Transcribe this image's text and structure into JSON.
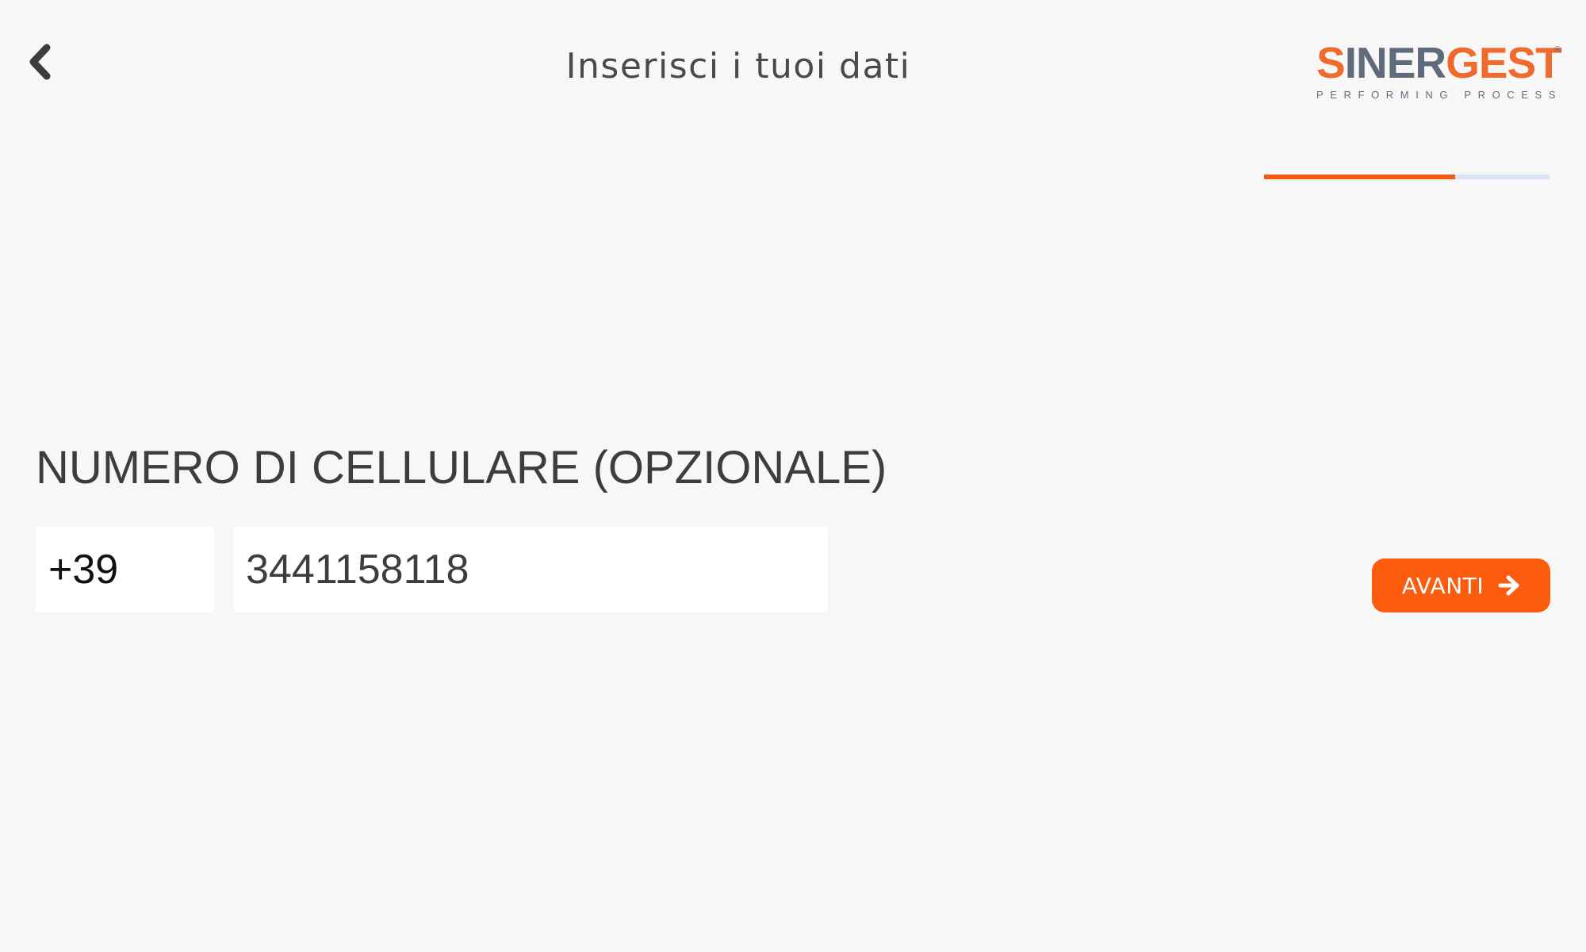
{
  "header": {
    "back_icon": "chevron-left-icon",
    "title": "Inserisci i tuoi dati"
  },
  "logo": {
    "word_accent_1": "S",
    "word_dark_1": "INER",
    "word_accent_2": "GEST",
    "registered": "®",
    "tagline": "PERFORMING PROCESS",
    "colors": {
      "accent": "#ef6a2c",
      "dark": "#5f6b7a"
    }
  },
  "progress": {
    "value": 0.67,
    "fill_color": "#f25a14",
    "track_color": "#d6e4f5"
  },
  "form": {
    "label": "NUMERO DI CELLULARE (OPZIONALE)",
    "country_code": "+39",
    "phone_number": "3441158118"
  },
  "next_button": {
    "label": "AVANTI",
    "icon": "arrow-right-icon",
    "color": "#fc5c0e"
  }
}
